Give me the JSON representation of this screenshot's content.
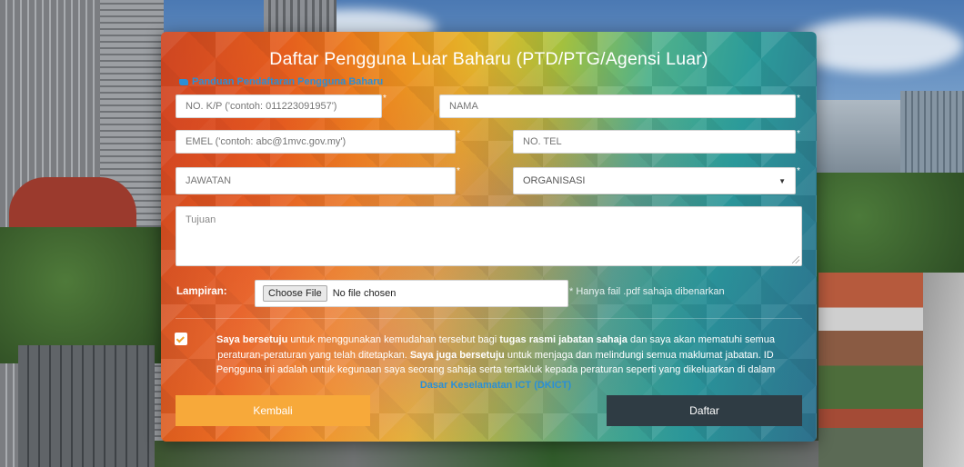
{
  "form": {
    "title": "Daftar Pengguna Luar Baharu (PTD/PTG/Agensi Luar)",
    "guide_link": "Panduan Pendaftaran Pengguna Baharu",
    "required_mark": "*",
    "fields": {
      "kp_placeholder": "NO. K/P ('contoh: 011223091957')",
      "nama_placeholder": "NAMA",
      "emel_placeholder": "EMEL ('contoh: abc@1mvc.gov.my')",
      "tel_placeholder": "NO. TEL",
      "jawatan_placeholder": "JAWATAN",
      "organisasi_selected": "ORGANISASI",
      "tujuan_placeholder": "Tujuan"
    },
    "attachment": {
      "label": "Lampiran:",
      "choose_button": "Choose File",
      "file_status": "No file chosen",
      "note": "* Hanya fail .pdf sahaja dibenarkan"
    },
    "agreement": {
      "checked": true,
      "part1_bold": "Saya bersetuju",
      "part2": " untuk menggunakan kemudahan tersebut bagi ",
      "part3_bold": "tugas rasmi jabatan sahaja",
      "part4": " dan saya akan mematuhi semua peraturan-peraturan yang telah ditetapkan. ",
      "part5_bold": "Saya juga bersetuju",
      "part6": " untuk menjaga dan melindungi semua maklumat jabatan. ID Pengguna ini adalah untuk kegunaan saya seorang sahaja serta tertakluk kepada peraturan seperti yang dikeluarkan di dalam ",
      "policy_link": "Dasar Keselamatan ICT (DKICT)"
    },
    "buttons": {
      "back": "Kembali",
      "register": "Daftar"
    }
  },
  "colors": {
    "accent_orange": "#f7a93a",
    "dark_button": "#2f3c44",
    "link_blue": "#2a8fd6"
  }
}
